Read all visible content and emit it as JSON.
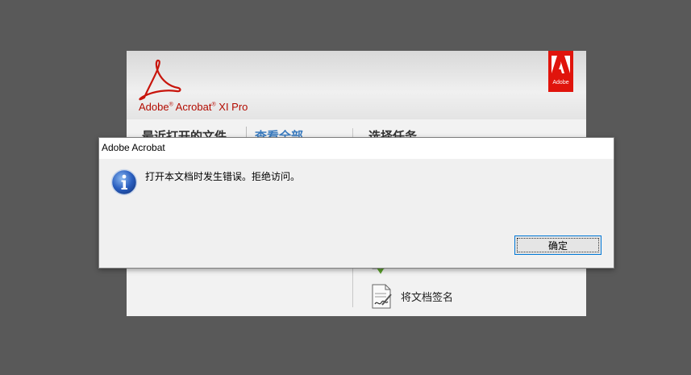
{
  "welcome": {
    "product_name": "Adobe",
    "product_name_acrobat": "Acrobat",
    "product_name_version": "XI Pro",
    "adobe_badge_text": "Adobe",
    "recent_files_title": "最近打开的文件",
    "view_all_link": "查看全部",
    "select_task_title": "选择任务",
    "tasks": [
      {
        "label": "将文档签名",
        "icon": "sign-document-icon"
      }
    ]
  },
  "dialog": {
    "title": "Adobe Acrobat",
    "message": "打开本文档时发生错误。拒绝访问。",
    "icon": "info-icon",
    "ok_button_label": "确定"
  },
  "colors": {
    "desktop_bg": "#595959",
    "adobe_red": "#e0140c",
    "link_blue": "#3a7bbf",
    "focus_blue": "#0078d7"
  }
}
